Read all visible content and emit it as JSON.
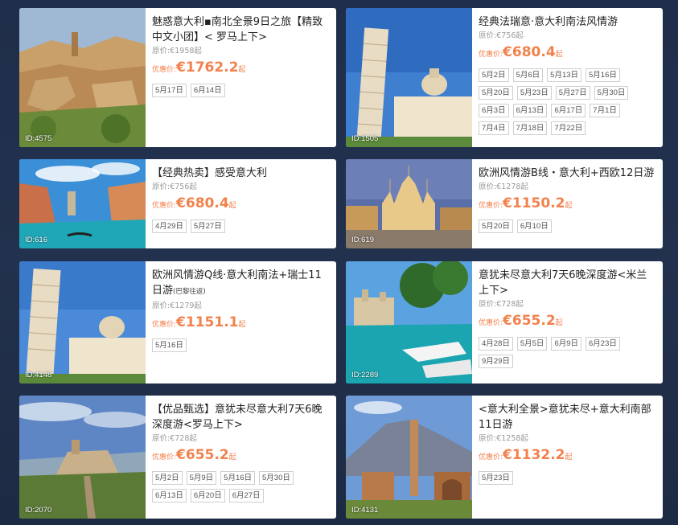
{
  "labels": {
    "orig_prefix": "原价:",
    "price_prefix": "优惠价:",
    "price_suffix": "起",
    "id_prefix": "ID:"
  },
  "cards": [
    {
      "id": "4575",
      "title": "魅惑意大利▪南北全景9日之旅【精致中文小团】< 罗马上下>",
      "note": "",
      "original": "€1958起",
      "price": "€1762.2",
      "dates": [
        "5月17日",
        "6月14日"
      ]
    },
    {
      "id": "1505",
      "title": "经典法瑞意·意大利南法风情游",
      "note": "",
      "original": "€756起",
      "price": "€680.4",
      "dates": [
        "5月2日",
        "5月6日",
        "5月13日",
        "5月16日",
        "5月20日",
        "5月23日",
        "5月27日",
        "5月30日",
        "6月3日",
        "6月13日",
        "6月17日",
        "7月1日",
        "7月4日",
        "7月18日",
        "7月22日"
      ]
    },
    {
      "id": "616",
      "title": "【经典热卖】感受意大利",
      "note": "",
      "original": "€756起",
      "price": "€680.4",
      "dates": [
        "4月29日",
        "5月27日"
      ]
    },
    {
      "id": "619",
      "title": "欧洲风情游B线・意大利+西欧12日游",
      "note": "",
      "original": "€1278起",
      "price": "€1150.2",
      "dates": [
        "5月20日",
        "6月10日"
      ]
    },
    {
      "id": "4148",
      "title": "欧洲风情游Q线·意大利南法+瑞士11日游",
      "note": "(巴黎往返)",
      "original": "€1279起",
      "price": "€1151.1",
      "dates": [
        "5月16日"
      ]
    },
    {
      "id": "2289",
      "title": "意犹未尽意大利7天6晚深度游<米兰上下>",
      "note": "",
      "original": "€728起",
      "price": "€655.2",
      "dates": [
        "4月28日",
        "5月5日",
        "6月9日",
        "6月23日",
        "9月29日"
      ]
    },
    {
      "id": "2070",
      "title": "【优品甄选】意犹未尽意大利7天6晚深度游<罗马上下>",
      "note": "",
      "original": "€728起",
      "price": "€655.2",
      "dates": [
        "5月2日",
        "5月9日",
        "5月16日",
        "5月30日",
        "6月13日",
        "6月20日",
        "6月27日"
      ]
    },
    {
      "id": "4131",
      "title": "<意大利全景>意犹未尽+意大利南部11日游",
      "note": "",
      "original": "€1258起",
      "price": "€1132.2",
      "dates": [
        "5月23日"
      ]
    }
  ],
  "colors": {
    "price": "#f2814c",
    "background": "#1f2e4a"
  }
}
